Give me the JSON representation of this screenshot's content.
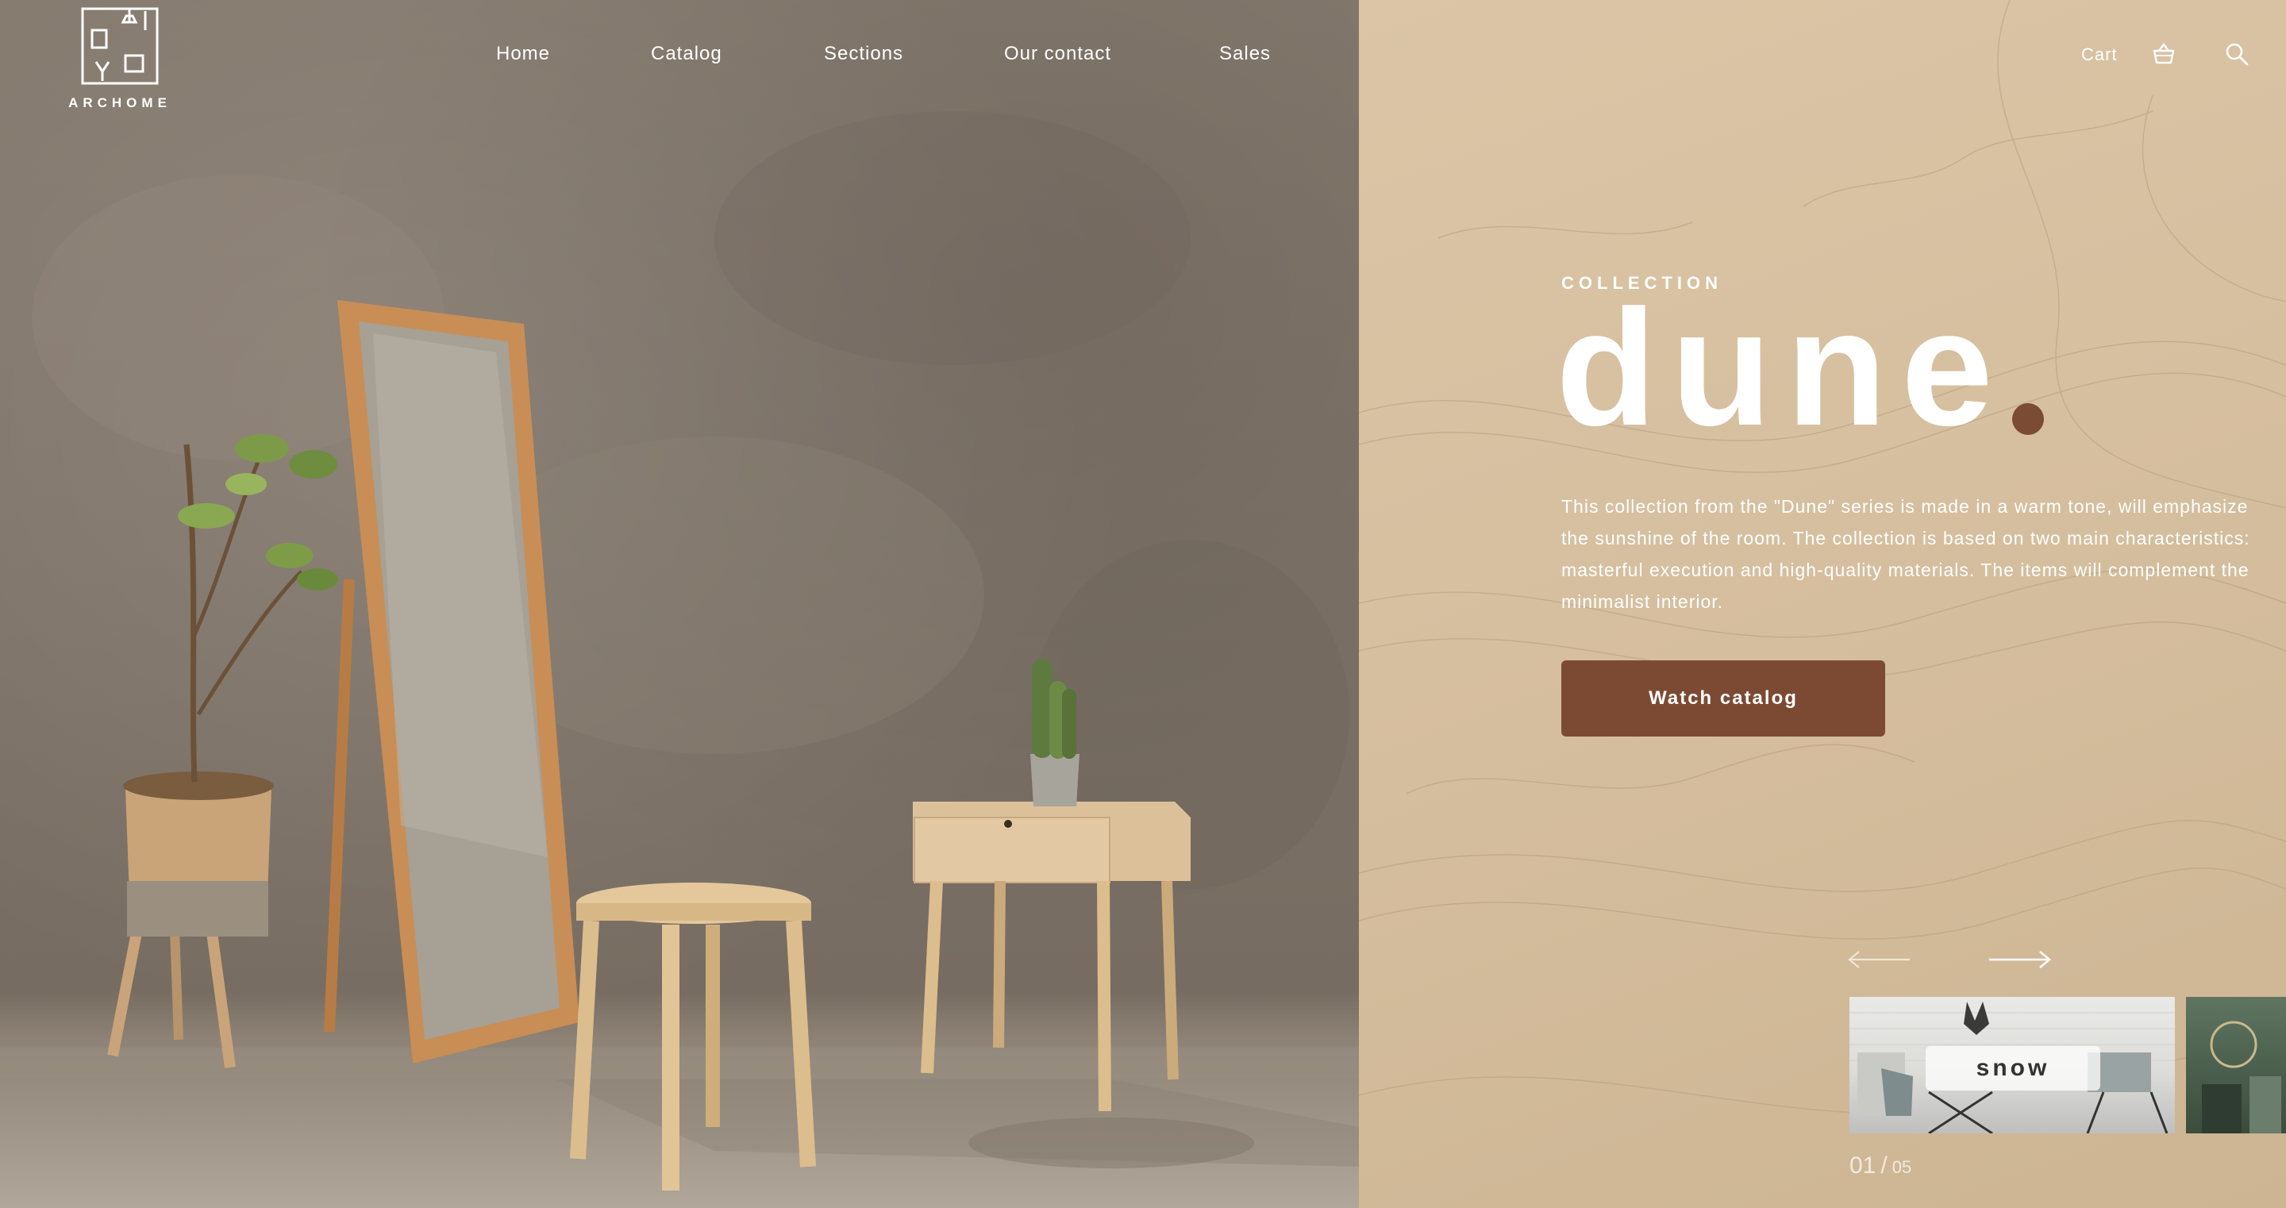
{
  "brand": {
    "name": "ARCHOME"
  },
  "nav": {
    "items": [
      {
        "label": "Home"
      },
      {
        "label": "Catalog"
      },
      {
        "label": "Sections"
      },
      {
        "label": "Our contact"
      },
      {
        "label": "Sales"
      }
    ]
  },
  "header": {
    "cart_label": "Cart",
    "cart_icon": "basket-icon",
    "search_icon": "search-icon"
  },
  "hero": {
    "eyebrow": "COLLECTION",
    "title": "dune",
    "description": "This collection from the \"Dune\" series is made in a warm tone, will emphasize the sunshine of the room. The collection is based on two main characteristics: masterful execution and high-quality materials. The items will complement the minimalist interior.",
    "cta_label": "Watch catalog"
  },
  "carousel": {
    "prev_icon": "arrow-left-icon",
    "next_icon": "arrow-right-icon",
    "slides": [
      {
        "label": "snow"
      },
      {
        "label": ""
      }
    ],
    "current": "01",
    "separator": "/",
    "total": "05"
  },
  "colors": {
    "accent": "#7c4a33",
    "panel_bg": "#d6bf9f",
    "text_light": "#ffffff"
  }
}
